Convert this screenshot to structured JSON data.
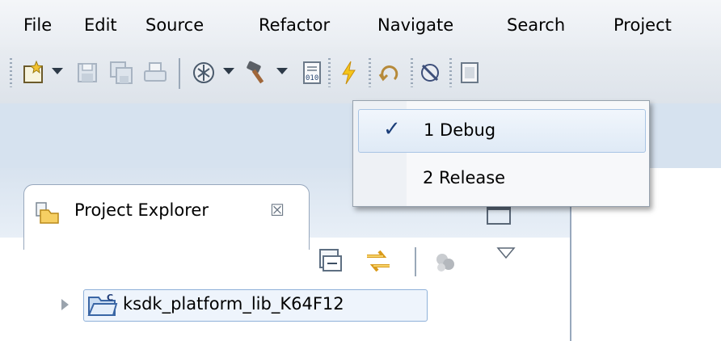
{
  "menubar": {
    "items": [
      "File",
      "Edit",
      "Source",
      "Refactor",
      "Navigate",
      "Search",
      "Project"
    ]
  },
  "toolbar": {
    "icons": [
      "new-icon",
      "save-icon",
      "save-all-icon",
      "print-icon",
      "debug-icon",
      "build-icon",
      "binary-file-icon",
      "flash-icon",
      "refresh-icon",
      "disconnect-icon",
      "console-icon"
    ]
  },
  "build_config_menu": {
    "items": [
      {
        "label": "1 Debug",
        "checked": true,
        "check_glyph": "✓"
      },
      {
        "label": "2 Release",
        "checked": false
      }
    ]
  },
  "project_explorer": {
    "title": "Project Explorer",
    "close_glyph": "☒",
    "tree": [
      {
        "label": "ksdk_platform_lib_K64F12",
        "expanded": false
      }
    ]
  },
  "colors": {
    "accent": "#8fb1d9",
    "band": "#d6e2ef"
  }
}
